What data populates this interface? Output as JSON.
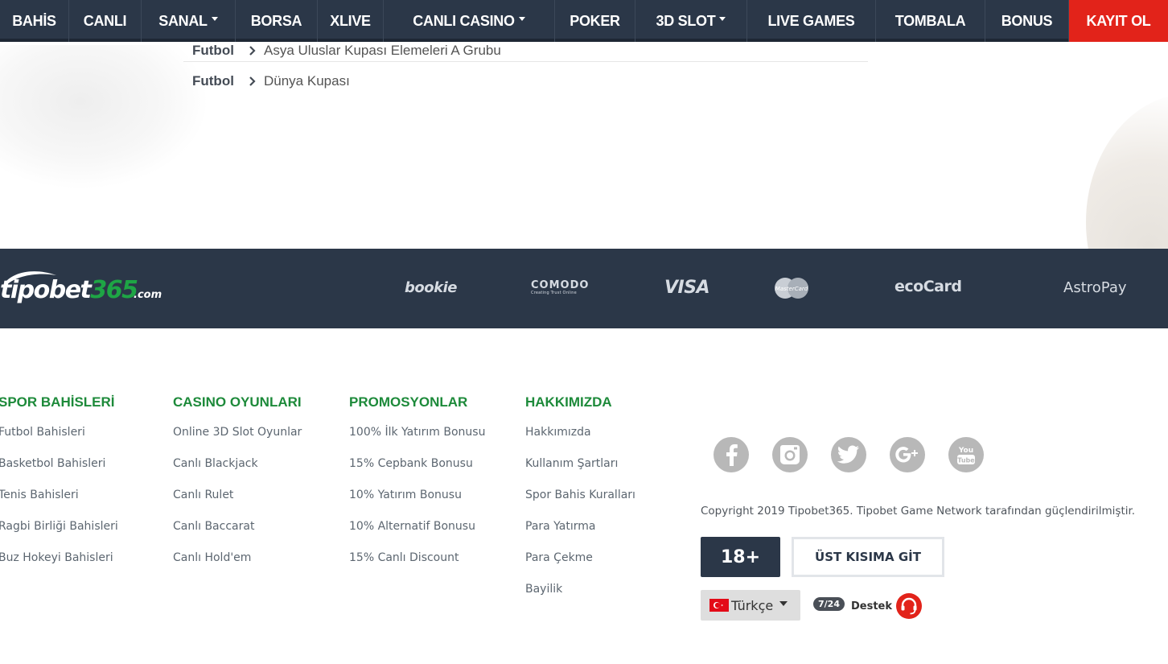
{
  "nav": {
    "items": [
      {
        "label": "BAHİS",
        "dropdown": false
      },
      {
        "label": "CANLI",
        "dropdown": false
      },
      {
        "label": "SANAL",
        "dropdown": true
      },
      {
        "label": "BORSA",
        "dropdown": false
      },
      {
        "label": "XLIVE",
        "dropdown": false
      },
      {
        "label": "CANLI CASINO",
        "dropdown": true
      },
      {
        "label": "POKER",
        "dropdown": false
      },
      {
        "label": "3D SLOT",
        "dropdown": true
      },
      {
        "label": "LIVE GAMES",
        "dropdown": false
      },
      {
        "label": "TOMBALA",
        "dropdown": false
      },
      {
        "label": "BONUS",
        "dropdown": false
      }
    ],
    "register_label": "KAYIT OL",
    "register_color": "#e2231a",
    "bar_color": "#2b3748"
  },
  "leagues": [
    {
      "sport": "Futbol",
      "name": "Asya Uluslar Kupası Elemeleri A Grubu"
    },
    {
      "sport": "Futbol",
      "name": "Dünya Kupası"
    }
  ],
  "brand": {
    "logo_part1": "tipo",
    "logo_part2": "bet",
    "logo_part3": "365",
    "logo_suffix": ".com",
    "accent": "#1ea545"
  },
  "payments": {
    "bookie": "bookie",
    "comodo": "COMODO",
    "comodo_sub": "Creating Trust Online",
    "visa": "VISA",
    "mastercard": "MasterCard",
    "ecocard": "ecoCard",
    "astropay": "AstroPay"
  },
  "footer": {
    "columns": [
      {
        "title": "SPOR BAHİSLERİ",
        "links": [
          "Futbol Bahisleri",
          "Basketbol Bahisleri",
          "Tenis Bahisleri",
          "Ragbi Birliği Bahisleri",
          "Buz Hokeyi Bahisleri"
        ]
      },
      {
        "title": "CASINO OYUNLARI",
        "links": [
          "Online 3D Slot Oyunlar",
          "Canlı Blackjack",
          "Canlı Rulet",
          "Canlı Baccarat",
          "Canlı Hold'em"
        ]
      },
      {
        "title": "PROMOSYONLAR",
        "links": [
          "100% İlk Yatırım Bonusu",
          "15% Cepbank Bonusu",
          "10% Yatırım Bonusu",
          "10% Alternatif Bonusu",
          "15% Canlı Discount"
        ]
      },
      {
        "title": "HAKKIMIZDA",
        "links": [
          "Hakkımızda",
          "Kullanım Şartları",
          "Spor Bahis Kuralları",
          "Para Yatırma",
          "Para Çekme",
          "Bayilik"
        ]
      }
    ],
    "social_icons": [
      "facebook-icon",
      "instagram-icon",
      "twitter-icon",
      "google-plus-icon",
      "youtube-icon"
    ],
    "youtube_you": "You",
    "youtube_tube": "Tube",
    "copyright": "Copyright 2019 Tipobet365. Tipobet Game Network tarafından güçlendirilmiştir.",
    "age_badge": "18+",
    "back_to_top": "ÜST KISIMA GİT",
    "language": "Türkçe",
    "support_hours": "7/24",
    "support_label": "Destek",
    "title_color": "#1d8a3a"
  }
}
